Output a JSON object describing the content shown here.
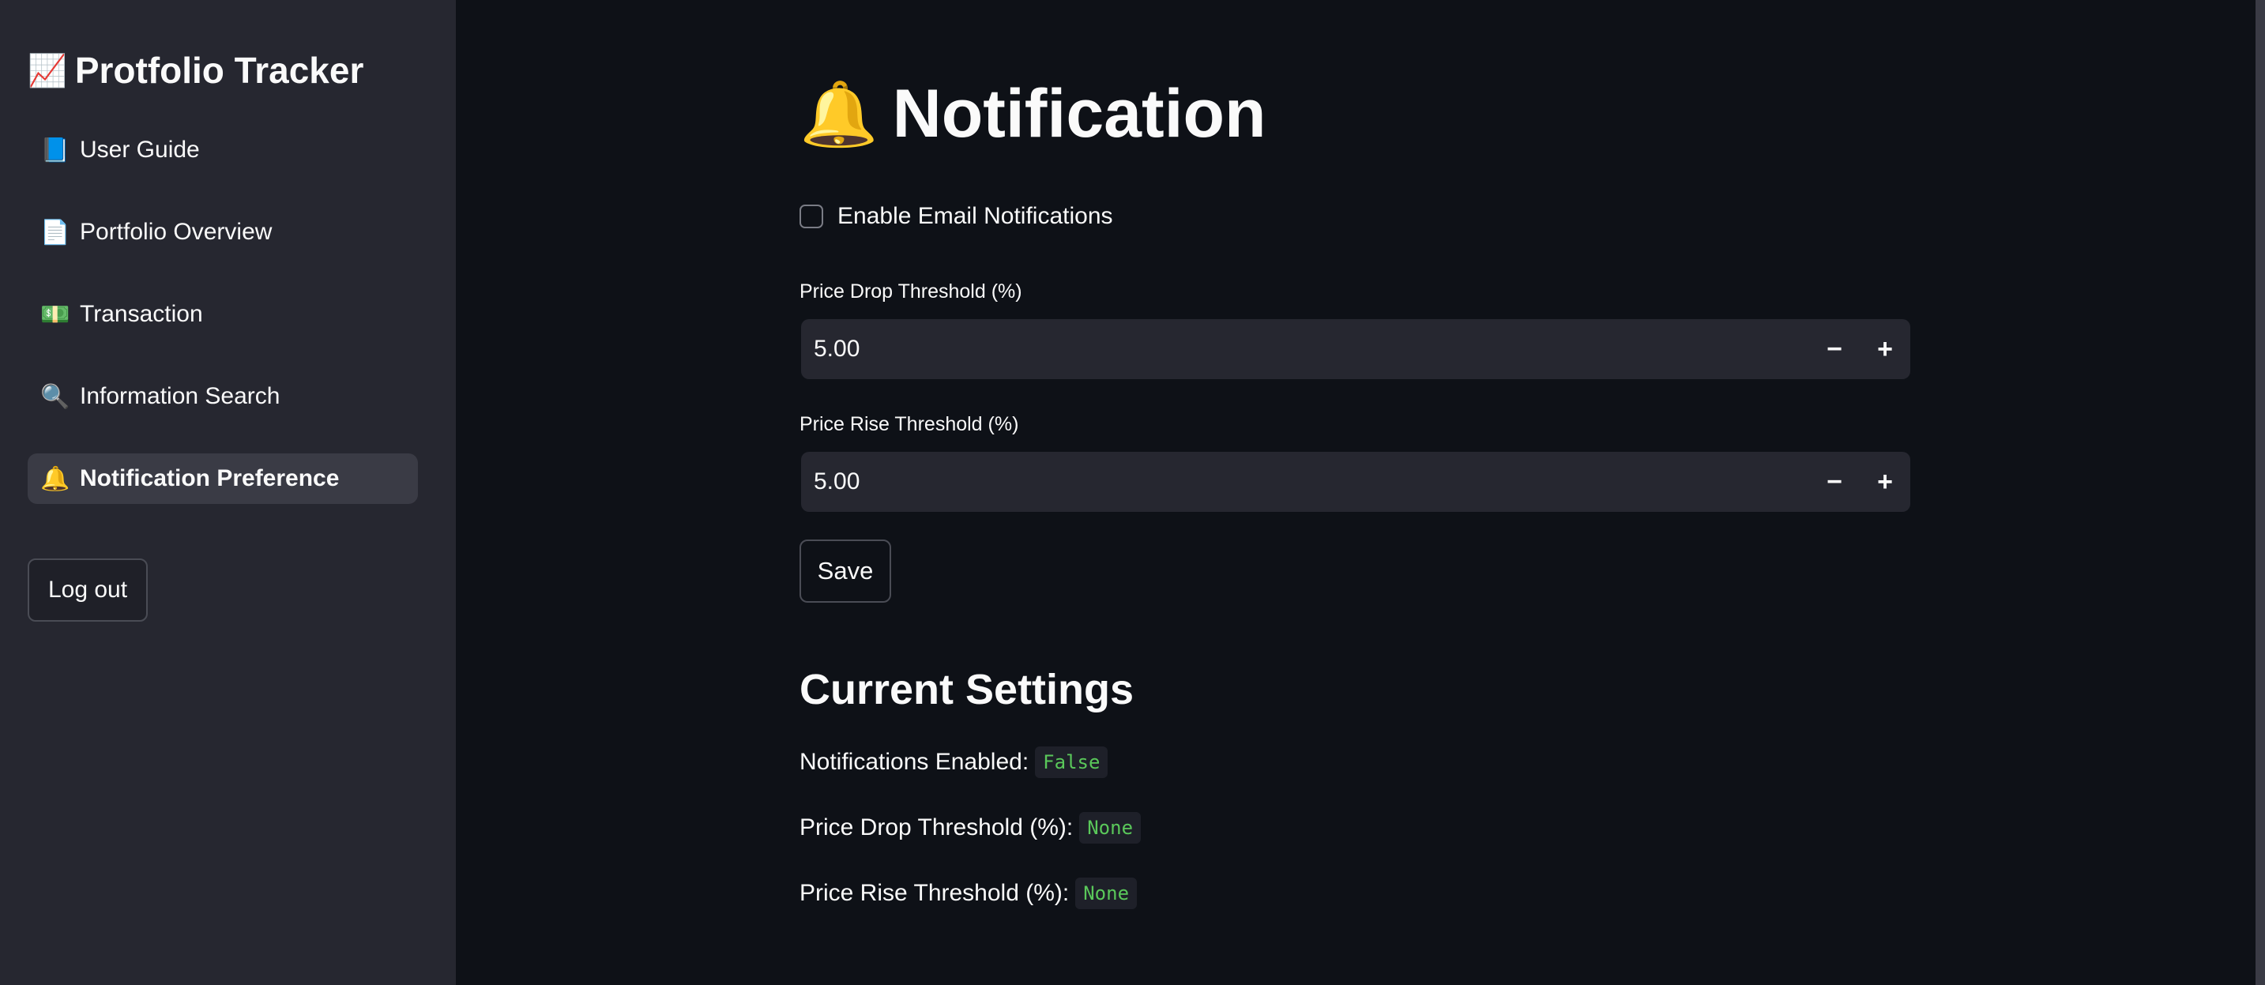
{
  "sidebar": {
    "title": "Protfolio Tracker",
    "title_icon": "📈",
    "items": [
      {
        "icon": "📘",
        "label": "User Guide"
      },
      {
        "icon": "📄",
        "label": "Portfolio Overview"
      },
      {
        "icon": "💵",
        "label": "Transaction"
      },
      {
        "icon": "🔍",
        "label": "Information Search"
      },
      {
        "icon": "🔔",
        "label": "Notification Preference"
      }
    ],
    "logout_label": "Log out"
  },
  "main": {
    "title": "Notification",
    "title_icon": "🔔",
    "email_checkbox": {
      "label": "Enable Email Notifications",
      "checked": false
    },
    "price_drop": {
      "label": "Price Drop Threshold (%)",
      "value": "5.00"
    },
    "price_rise": {
      "label": "Price Rise Threshold (%)",
      "value": "5.00"
    },
    "minus": "−",
    "plus": "+",
    "save_label": "Save",
    "current_settings": {
      "title": "Current Settings",
      "rows": [
        {
          "label": "Notifications Enabled:",
          "value": "False"
        },
        {
          "label": "Price Drop Threshold (%):",
          "value": "None"
        },
        {
          "label": "Price Rise Threshold (%):",
          "value": "None"
        }
      ]
    }
  },
  "colors": {
    "background": "#0e1117",
    "sidebar": "#262730",
    "code_text": "#5ac85a"
  }
}
